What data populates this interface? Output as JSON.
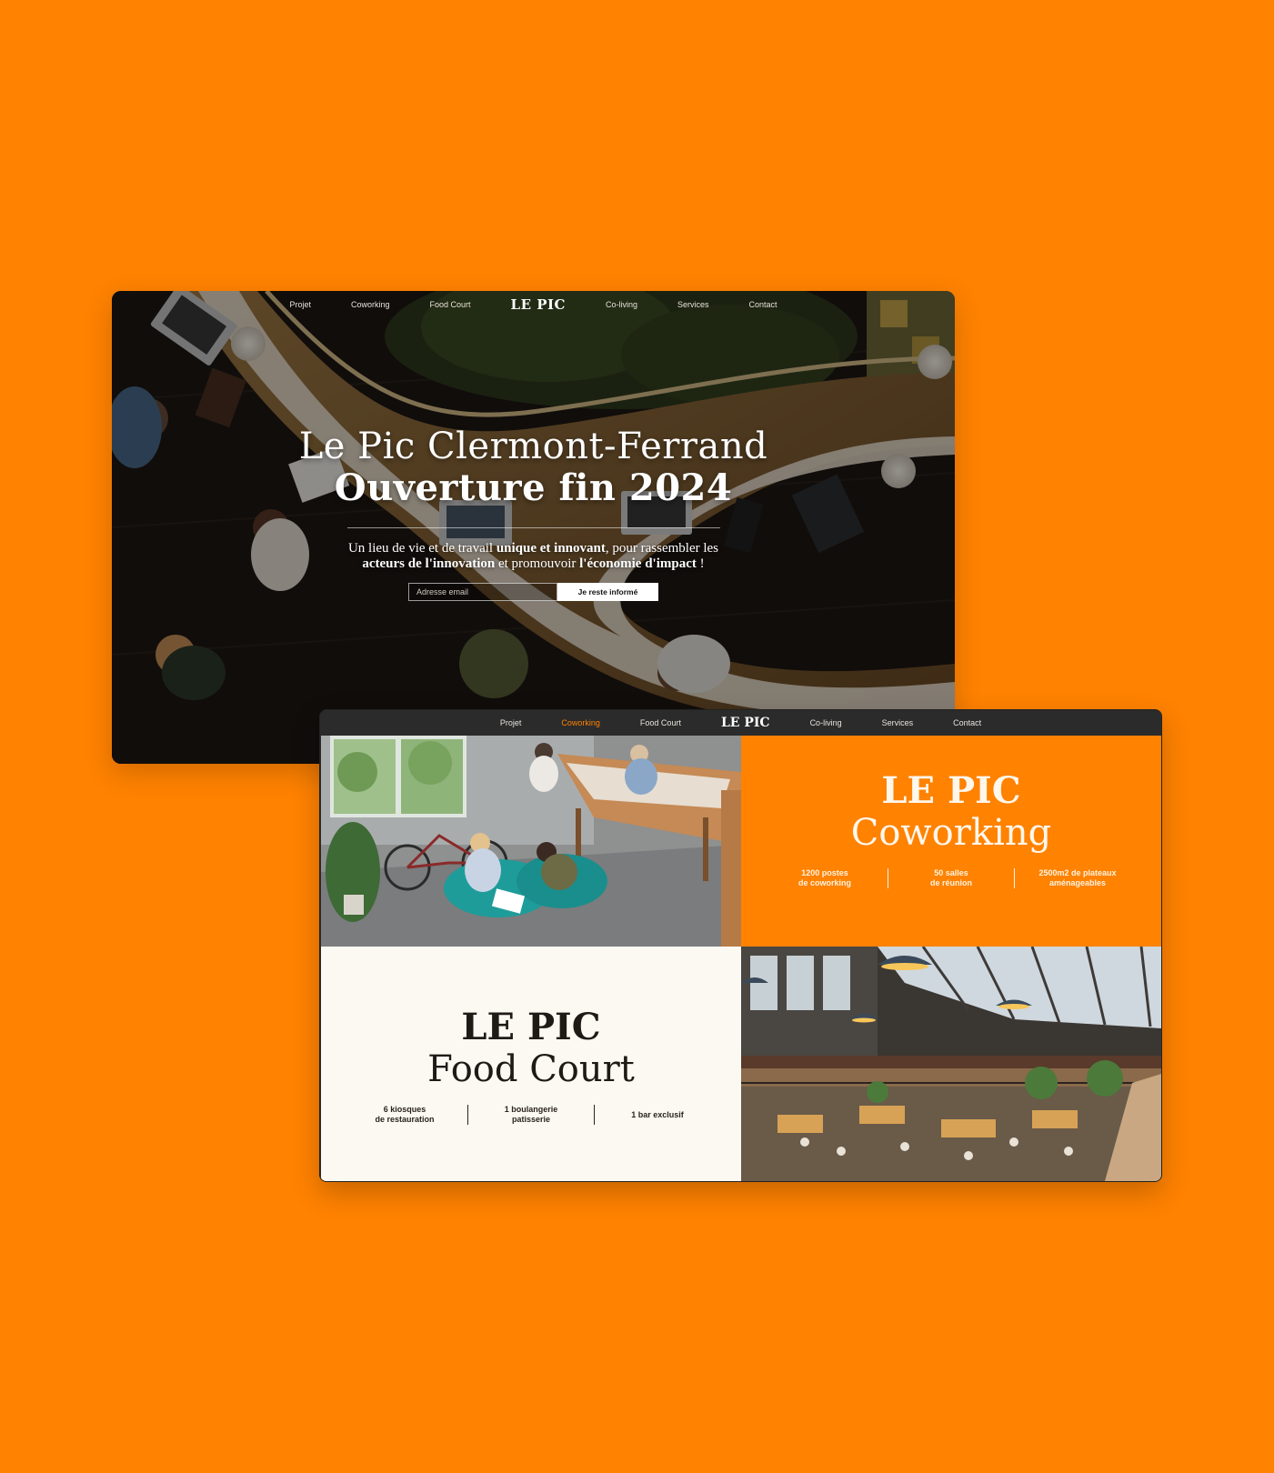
{
  "colors": {
    "background": "#ff8200",
    "accent": "#ff8200",
    "nav_dark": "#2b2b2b",
    "cream": "#fcf8f2"
  },
  "hero": {
    "nav": {
      "items_left": [
        "Projet",
        "Coworking",
        "Food Court"
      ],
      "logo": "LE PIC",
      "items_right": [
        "Co-living",
        "Services",
        "Contact"
      ]
    },
    "title_line1": "Le Pic Clermont-Ferrand",
    "title_line2": "Ouverture fin 2024",
    "text_part1": "Un lieu de vie et de travail ",
    "text_bold1": "unique et innovant",
    "text_part2": ", pour rassembler les ",
    "text_bold2": "acteurs de l'innovation",
    "text_part3": " et promouvoir ",
    "text_bold3": "l'économie d'impact",
    "text_part4": " !",
    "email_placeholder": "Adresse email",
    "email_value": "",
    "cta_label": "Je reste informé",
    "image": "overhead-coworking-desk-photo"
  },
  "grid_page": {
    "nav": {
      "items_left": [
        "Projet",
        "Coworking",
        "Food Court"
      ],
      "logo": "LE PIC",
      "items_right": [
        "Co-living",
        "Services",
        "Contact"
      ],
      "active": "Coworking"
    },
    "coworking": {
      "title_line1": "LE PIC",
      "title_line2": "Coworking",
      "stats": [
        {
          "line1": "1200 postes",
          "line2": "de coworking"
        },
        {
          "line1": "50 salles",
          "line2": "de réunion"
        },
        {
          "line1": "2500m2 de plateaux",
          "line2": "aménageables"
        }
      ],
      "image": "coworking-beanbags-photo"
    },
    "food_court": {
      "title_line1": "LE PIC",
      "title_line2": "Food Court",
      "stats": [
        {
          "line1": "6 kiosques",
          "line2": "de restauration"
        },
        {
          "line1": "1 boulangerie",
          "line2": "patisserie"
        },
        {
          "line1": "1 bar exclusif",
          "line2": ""
        }
      ],
      "image": "food-hall-interior-photo"
    }
  }
}
